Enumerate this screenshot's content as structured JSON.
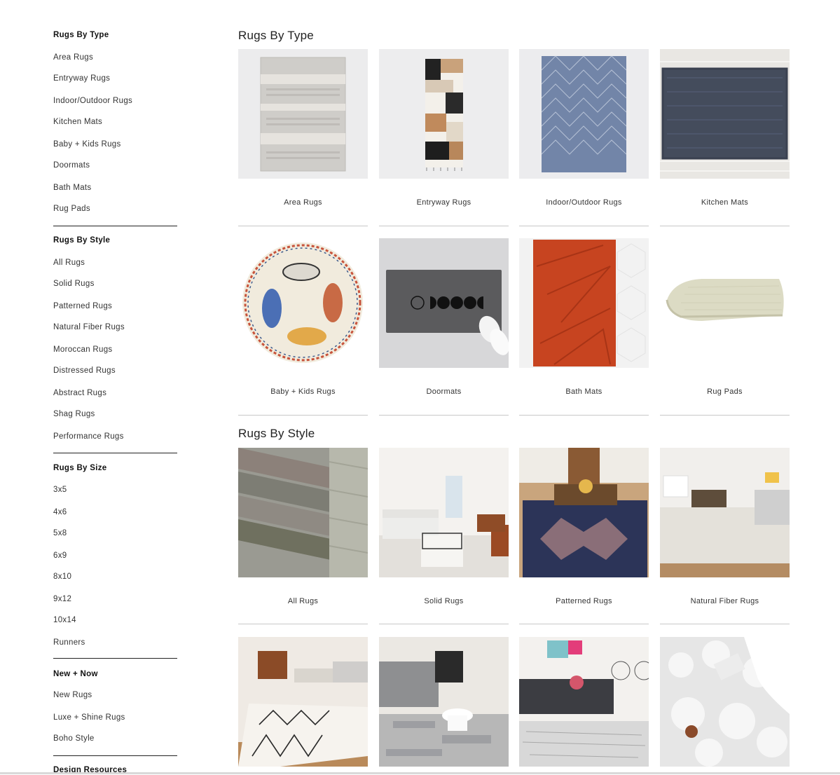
{
  "sidebar": {
    "groups": [
      {
        "heading": "Rugs By Type",
        "links": [
          "Area Rugs",
          "Entryway Rugs",
          "Indoor/Outdoor Rugs",
          "Kitchen Mats",
          "Baby + Kids Rugs",
          "Doormats",
          "Bath Mats",
          "Rug Pads"
        ]
      },
      {
        "heading": "Rugs By Style",
        "links": [
          "All Rugs",
          "Solid Rugs",
          "Patterned Rugs",
          "Natural Fiber Rugs",
          "Moroccan Rugs",
          "Distressed Rugs",
          "Abstract Rugs",
          "Shag Rugs",
          "Performance Rugs"
        ]
      },
      {
        "heading": "Rugs By Size",
        "links": [
          "3x5",
          "4x6",
          "5x8",
          "6x9",
          "8x10",
          "9x12",
          "10x14",
          "Runners"
        ]
      },
      {
        "heading": "New + Now",
        "links": [
          "New Rugs",
          "Luxe + Shine Rugs",
          "Boho Style"
        ]
      },
      {
        "heading": "Design Resources",
        "links": []
      }
    ]
  },
  "main": {
    "sections": [
      {
        "title": "Rugs By Type",
        "tiles": [
          {
            "label": "Area Rugs",
            "image": "grey-patterned-area-rug"
          },
          {
            "label": "Entryway Rugs",
            "image": "geometric-runner-rug"
          },
          {
            "label": "Indoor/Outdoor Rugs",
            "image": "blue-diamond-outdoor-rug"
          },
          {
            "label": "Kitchen Mats",
            "image": "navy-woven-kitchen-mat"
          },
          {
            "label": "Baby + Kids Rugs",
            "image": "round-animal-kids-rug"
          },
          {
            "label": "Doormats",
            "image": "moon-phase-doormat"
          },
          {
            "label": "Bath Mats",
            "image": "orange-bath-mat"
          },
          {
            "label": "Rug Pads",
            "image": "folded-rug-pad"
          }
        ]
      },
      {
        "title": "Rugs By Style",
        "tiles": [
          {
            "label": "All Rugs",
            "image": "rolled-rugs"
          },
          {
            "label": "Solid Rugs",
            "image": "white-living-room"
          },
          {
            "label": "Patterned Rugs",
            "image": "navy-patterned-dining-rug"
          },
          {
            "label": "Natural Fiber Rugs",
            "image": "natural-fiber-living-room"
          },
          {
            "label": "",
            "image": "moroccan-rug-living-room"
          },
          {
            "label": "",
            "image": "distressed-rug-living-room"
          },
          {
            "label": "",
            "image": "abstract-rug-sofa"
          },
          {
            "label": "",
            "image": "white-shag-rug"
          }
        ]
      }
    ]
  }
}
